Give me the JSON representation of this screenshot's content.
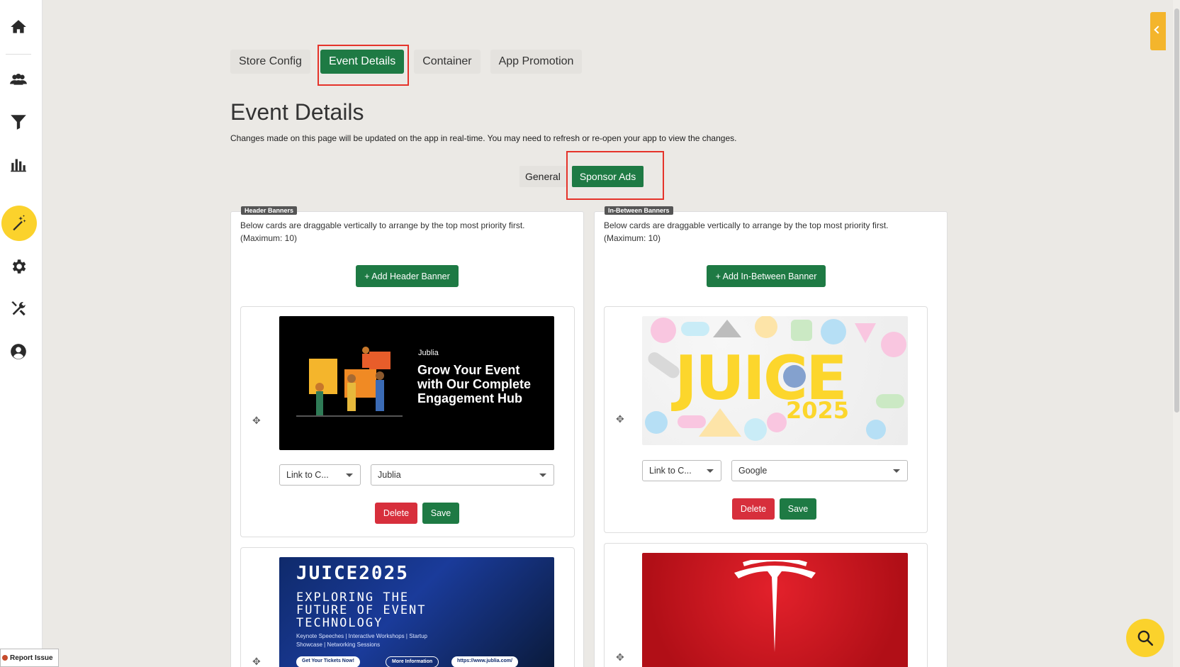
{
  "tabs": [
    {
      "label": "Store Config"
    },
    {
      "label": "Event Details",
      "active": true
    },
    {
      "label": "Container"
    },
    {
      "label": "App Promotion"
    }
  ],
  "page": {
    "title": "Event Details",
    "subtitle": "Changes made on this page will be updated on the app in real-time. You may need to refresh or re-open your app to view the changes."
  },
  "subtabs": [
    {
      "label": "General"
    },
    {
      "label": "Sponsor Ads",
      "active": true
    }
  ],
  "header_panel": {
    "label": "Header Banners",
    "desc_line1": "Below cards are draggable vertically to arrange by the top most priority first.",
    "desc_line2": "(Maximum: 10)",
    "add_label": "+ Add Header Banner",
    "cards": [
      {
        "banner_brand": "Jublia",
        "banner_headline": "Grow Your Event with Our Complete Engagement Hub",
        "link_type": "Link to C...",
        "target": "Jublia",
        "delete_label": "Delete",
        "save_label": "Save"
      },
      {
        "banner_title": "JUICE2025",
        "banner_sub": "EXPLORING THE FUTURE OF EVENT TECHNOLOGY",
        "banner_detail": "Keynote Speeches | Interactive Workshops | Startup Showcase | Networking Sessions",
        "banner_cta1": "Get Your Tickets Now!",
        "banner_cta2": "More Information",
        "banner_url": "https://www.jublia.com/"
      }
    ]
  },
  "between_panel": {
    "label": "In-Between Banners",
    "desc_line1": "Below cards are draggable vertically to arrange by the top most priority first.",
    "desc_line2": "(Maximum: 10)",
    "add_label": "+ Add In-Between Banner",
    "cards": [
      {
        "banner_title": "JUICE",
        "banner_year": "2025",
        "link_type": "Link to C...",
        "target": "Google",
        "delete_label": "Delete",
        "save_label": "Save"
      },
      {
        "banner_brand": "Tesla"
      }
    ]
  },
  "footer": {
    "report_label": "Report Issue"
  },
  "sidebar": {
    "icons": [
      "home-icon",
      "users-icon",
      "filter-icon",
      "chart-icon",
      "magic-wand-icon",
      "gear-icon",
      "tools-icon",
      "account-icon"
    ]
  },
  "colors": {
    "primary_green": "#1e7a44",
    "danger_red": "#d72f3c",
    "accent_yellow": "#fbd22c",
    "highlight_red": "#e5332a"
  }
}
